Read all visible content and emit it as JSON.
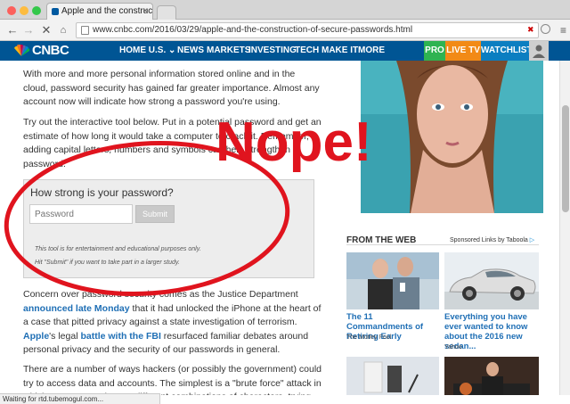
{
  "browser": {
    "tab_title": "Apple and the construction",
    "url": "www.cnbc.com/2016/03/29/apple-and-the-construction-of-secure-passwords.html",
    "status_text": "Waiting for rtd.tubemogul.com..."
  },
  "nav": {
    "logo": "CNBC",
    "items": [
      "HOME U.S. ⌄",
      "NEWS",
      "MARKETS",
      "INVESTING",
      "TECH",
      "MAKE IT",
      "MORE"
    ],
    "pro": "PRO",
    "live_tv": "LIVE TV",
    "watchlist": "WATCHLIST"
  },
  "article": {
    "p1": "With more and more personal information stored online and in the cloud, password security has gained far greater importance. Almost any account now will indicate how strong a password you're using.",
    "p2": "Try out the interactive tool below. Put in a potential password and get an estimate of how long it would take a computer to crack it. Remember, adding capital letters, numbers and symbols can help strengthen a password.",
    "widget": {
      "title": "How strong is your password?",
      "placeholder": "Password",
      "submit": "Submit",
      "disclaimer1": "This tool is for entertainment and educational purposes only.",
      "disclaimer2": "Hit \"Submit\" if you want to take part in a larger study."
    },
    "p3_a": "Concern over password security comes as the Justice Department ",
    "p3_link1": "announced late Monday",
    "p3_b": " that it had unlocked the iPhone at the heart of a case that pitted privacy against a state investigation of terrorism. ",
    "p3_link2": "Apple",
    "p3_c": "'s legal ",
    "p3_link3": "battle with the FBI",
    "p3_d": " resurfaced familiar debates around personal privacy and the security of our passwords in general.",
    "p4": "There are a number of ways hackers (or possibly the government) could try to access data and accounts. The simplest is a \"brute force\" attack in which a computer tries out different combinations of characters, trying"
  },
  "overlay": {
    "text": "Nope!",
    "color": "#e0141e"
  },
  "sidebar": {
    "heading": "FROM THE WEB",
    "sponsored": "Sponsored Links by Taboola",
    "cards": [
      {
        "title": "The 11 Commandments of Retiring Early",
        "source": "The Motley Fool"
      },
      {
        "title": "Everything you have ever wanted to know about the 2016 new sedan...",
        "source": "Yahoo"
      }
    ]
  },
  "colors": {
    "nav_bg": "#005594",
    "link": "#1f6fb5",
    "pro": "#2eb351",
    "live": "#f28a16",
    "watchlist": "#0b7ec1"
  }
}
